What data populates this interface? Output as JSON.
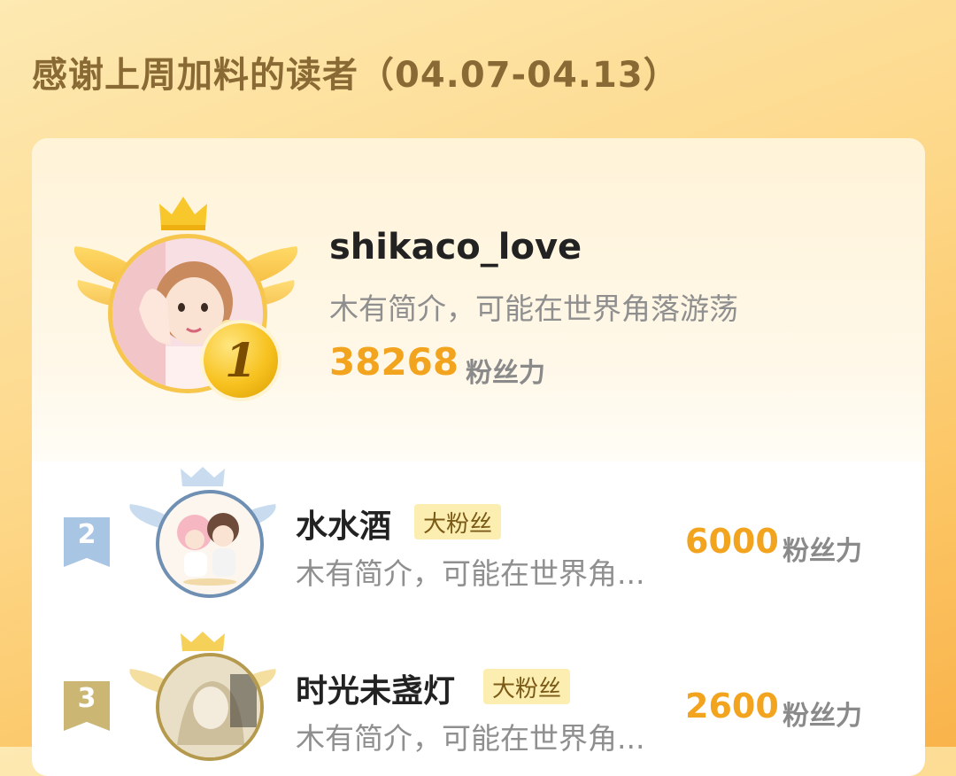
{
  "page_title": "感谢上周加料的读者（04.07-04.13）",
  "top_reader": {
    "rank": "1",
    "name": "shikaco_love",
    "bio": "木有简介，可能在世界角落游荡",
    "score": "38268",
    "score_unit": "粉丝力"
  },
  "readers": [
    {
      "rank": "2",
      "name": "水水酒",
      "badge": "大粉丝",
      "bio": "木有简介，可能在世界角...",
      "score": "6000",
      "score_unit": "粉丝力"
    },
    {
      "rank": "3",
      "name": "时光未盏灯",
      "badge": "大粉丝",
      "bio": "木有简介，可能在世界角...",
      "score": "2600",
      "score_unit": "粉丝力"
    }
  ],
  "colors": {
    "accent_score": "#f3a41f",
    "gold": "#f7c21f",
    "silver_blue": "#8fb4d9",
    "bronze": "#c9b06a"
  },
  "icons": [
    "crown-icon",
    "wings-icon",
    "rank-medal-icon",
    "rank-flag-icon"
  ]
}
